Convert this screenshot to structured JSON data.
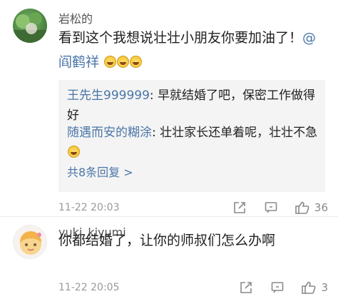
{
  "comments": [
    {
      "username": "岩松的",
      "text_prefix": "看到这个我想说壮壮小朋友你要加油了！",
      "mention": "@阎鹤祥",
      "emoji_names": [
        "laugh-cry-emoji",
        "laugh-cry-emoji",
        "laugh-cry-emoji"
      ],
      "replies": [
        {
          "name": "王先生999999",
          "text": ": 早就结婚了吧，保密工作做得好"
        },
        {
          "name": "随遇而安的糊涂",
          "text": ": 壮壮家长还单着呢，壮壮不急"
        }
      ],
      "more_replies": "共8条回复 >",
      "time": "11-22 20:03",
      "likes": "36"
    },
    {
      "username": "yuki_kiyumi",
      "text": "你都结婚了，让你的师叔们怎么办啊",
      "time": "11-22 20:05",
      "likes": "3"
    }
  ],
  "icons": {
    "share": "share-icon",
    "comment": "comment-icon",
    "like": "thumbs-up-icon"
  }
}
